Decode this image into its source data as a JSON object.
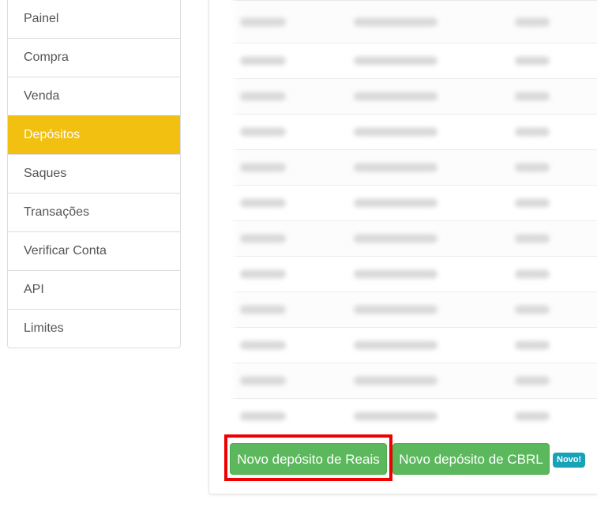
{
  "sidebar": {
    "items": [
      {
        "label": "Painel",
        "active": false
      },
      {
        "label": "Compra",
        "active": false
      },
      {
        "label": "Venda",
        "active": false
      },
      {
        "label": "Depósitos",
        "active": true
      },
      {
        "label": "Saques",
        "active": false
      },
      {
        "label": "Transações",
        "active": false
      },
      {
        "label": "Verificar Conta",
        "active": false
      },
      {
        "label": "API",
        "active": false
      },
      {
        "label": "Limites",
        "active": false
      }
    ],
    "active_color": "#f2c011"
  },
  "deposits_table": {
    "row_count": 12,
    "content": "blurred"
  },
  "actions": {
    "new_reais_deposit_label": "Novo depósito de Reais",
    "new_cbrl_deposit_label": "Novo depósito de CBRL",
    "new_badge_label": "Novo!",
    "button_color": "#5cb85c",
    "badge_color": "#17a2b8",
    "highlight_color": "#ee0000"
  }
}
